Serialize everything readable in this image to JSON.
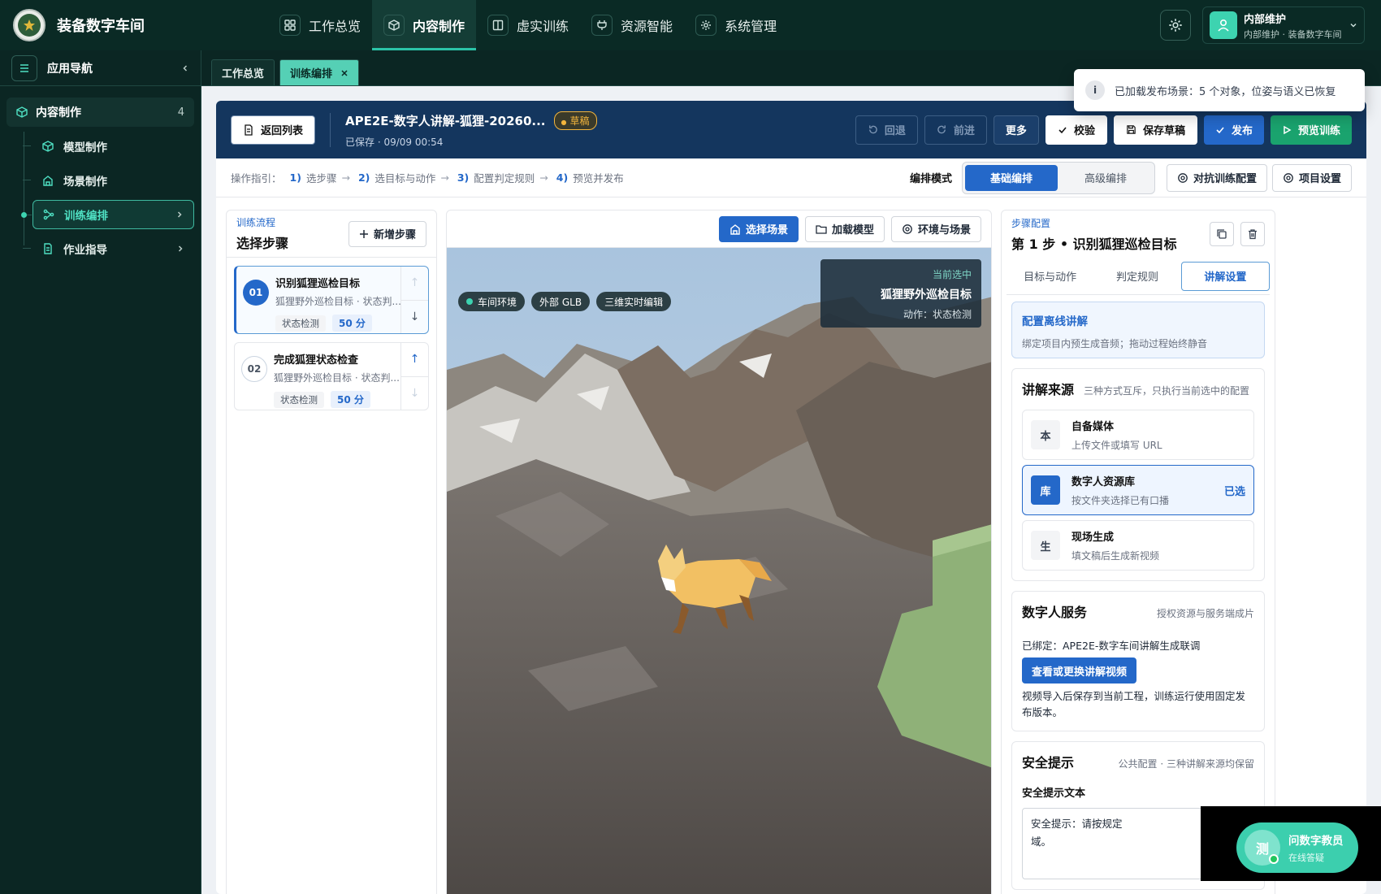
{
  "app": {
    "title": "装备数字车间"
  },
  "topnav": [
    {
      "label": "工作总览",
      "icon": "grid-icon"
    },
    {
      "label": "内容制作",
      "icon": "cube-icon",
      "active": true
    },
    {
      "label": "虚实训练",
      "icon": "book-icon"
    },
    {
      "label": "资源智能",
      "icon": "plug-icon"
    },
    {
      "label": "系统管理",
      "icon": "gear-icon"
    }
  ],
  "user": {
    "name": "内部维护",
    "sub": "内部维护 · 装备数字车间"
  },
  "sidebar": {
    "title": "应用导航",
    "group": {
      "label": "内容制作",
      "count": "4"
    },
    "items": [
      {
        "label": "模型制作",
        "icon": "cube-icon"
      },
      {
        "label": "场景制作",
        "icon": "building-icon"
      },
      {
        "label": "训练编排",
        "icon": "flow-icon",
        "active": true
      },
      {
        "label": "作业指导",
        "icon": "document-icon"
      }
    ]
  },
  "tabs": [
    {
      "label": "工作总览"
    },
    {
      "label": "训练编排",
      "active": true
    }
  ],
  "toast": {
    "text": "已加载发布场景：5 个对象，位姿与语义已恢复"
  },
  "header": {
    "back": "返回列表",
    "project": "APE2E-数字人讲解-狐狸-20260...",
    "status": "草稿",
    "saved": "已保存 · 09/09 00:54",
    "undo": "回退",
    "redo": "前进",
    "more": "更多",
    "validate": "校验",
    "save_draft": "保存草稿",
    "publish": "发布",
    "preview": "预览训练"
  },
  "guide": {
    "label": "操作指引：",
    "steps": [
      {
        "n": "1)",
        "t": "选步骤"
      },
      {
        "n": "2)",
        "t": "选目标与动作"
      },
      {
        "n": "3)",
        "t": "配置判定规则"
      },
      {
        "n": "4)",
        "t": "预览并发布"
      }
    ],
    "mode_label": "编排模式",
    "mode_basic": "基础编排",
    "mode_advanced": "高级编排",
    "btn_adversarial": "对抗训练配置",
    "btn_project": "项目设置"
  },
  "flow": {
    "kicker": "训练流程",
    "title": "选择步骤",
    "add": "新增步骤",
    "steps": [
      {
        "num": "01",
        "title": "识别狐狸巡检目标",
        "desc": "狐狸野外巡检目标 · 状态判...",
        "tag": "状态检测",
        "score": "50 分"
      },
      {
        "num": "02",
        "title": "完成狐狸状态检查",
        "desc": "狐狸野外巡检目标 · 状态判...",
        "tag": "状态检测",
        "score": "50 分"
      }
    ]
  },
  "viewport": {
    "btn_scene": "选择场景",
    "btn_load": "加载模型",
    "btn_env": "环境与场景",
    "chips": [
      "车间环境",
      "外部 GLB",
      "三维实时编辑"
    ],
    "selected_kicker": "当前选中",
    "selected_title": "狐狸野外巡检目标",
    "selected_action": "动作：状态检测"
  },
  "config": {
    "kicker": "步骤配置",
    "title": "第 1 步 • 识别狐狸巡检目标",
    "tabs": [
      "目标与动作",
      "判定规则",
      "讲解设置"
    ],
    "offline_title": "配置离线讲解",
    "offline_desc": "绑定项目内预生成音频；拖动过程始终静音",
    "source_title": "讲解来源",
    "source_sub": "三种方式互斥，只执行当前选中的配置",
    "options": [
      {
        "icon": "本",
        "title": "自备媒体",
        "desc": "上传文件或填写 URL",
        "right": ""
      },
      {
        "icon": "库",
        "title": "数字人资源库",
        "desc": "按文件夹选择已有口播",
        "right": "已选"
      },
      {
        "icon": "生",
        "title": "现场生成",
        "desc": "填文稿后生成新视频",
        "right": ""
      }
    ],
    "dh_title": "数字人服务",
    "dh_sub": "授权资源与服务端成片",
    "dh_bound": "已绑定：APE2E-数字车间讲解生成联调",
    "dh_btn": "查看或更换讲解视频",
    "dh_note": "视频导入后保存到当前工程，训练运行使用固定发布版本。",
    "safety_title": "安全提示",
    "safety_sub": "公共配置 · 三种讲解来源均保留",
    "safety_label": "安全提示文本",
    "safety_text": "安全提示：请按规定",
    "safety_text2": "域。"
  },
  "assistant": {
    "avatar": "测",
    "title": "问数字教员",
    "sub": "在线答疑"
  }
}
